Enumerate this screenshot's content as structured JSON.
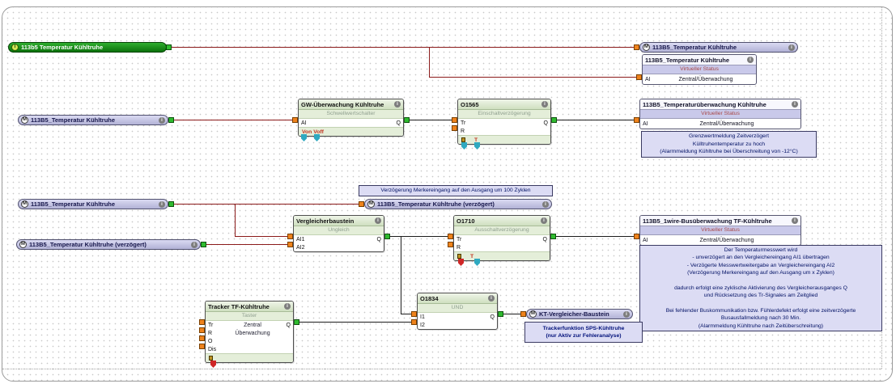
{
  "colors": {
    "analog_wire": "#8b1a1a",
    "binary_wire": "#1c1c1c",
    "input_port": "#ef831c",
    "output_port": "#2fbb2f",
    "merker_pill_fill": "#c8c8ea",
    "input_pill_fill": "#169416",
    "note_fill": "#dcdcf4"
  },
  "icons": {
    "info": "i"
  },
  "pills": {
    "input_temp": {
      "badge": "I",
      "label": "113b5  Temperatur Kühltruhe"
    },
    "m_temp_top": {
      "badge": "M",
      "label": "113B5_Temperatur Kühltruhe"
    },
    "m_temp_left1": {
      "badge": "M",
      "label": "113B5_Temperatur Kühltruhe"
    },
    "m_temp_left2": {
      "badge": "M",
      "label": "113B5_Temperatur Kühltruhe"
    },
    "m_temp_delayed_left": {
      "badge": "M",
      "label": "113B5_Temperatur Kühltruhe (verzögert)"
    },
    "m_temp_delayed_mid": {
      "badge": "M",
      "label": "113B5_Temperatur Kühltruhe (verzögert)"
    },
    "m_kt_vergleicher": {
      "badge": "M",
      "label": "KT-Vergleicher-Baustein"
    }
  },
  "status_blocks": {
    "temp": {
      "title": "113B5_Temperatur Kühltruhe",
      "subtitle": "Virtueller Status",
      "port": "AI",
      "value": "Zentral/Überwachung"
    },
    "ueberwachung": {
      "title": "113B5_Temperaturüberwachung Kühltruhe",
      "subtitle": "Virtueller Status",
      "port": "AI",
      "value": "Zentral/Überwachung"
    },
    "onewire": {
      "title": "113B5_1wire-Busüberwachung TF-Kühltruhe",
      "subtitle": "Virtueller Status",
      "port": "AI",
      "value": "Zentral/Überwachung"
    }
  },
  "blocks": {
    "gw": {
      "title": "GW-Überwachung Kühltruhe",
      "subtitle": "Schwellwertschalter",
      "in1": "AI",
      "out": "Q",
      "footer": "Von Voff"
    },
    "o1565": {
      "title": "O1565",
      "subtitle": "Einschaltverzögerung",
      "in1": "Tr",
      "in2": "R",
      "out": "Q",
      "param": "T"
    },
    "vergleicher": {
      "title": "Vergleicherbaustein",
      "subtitle": "Ungleich",
      "in1": "AI1",
      "in2": "AI2",
      "out": "Q"
    },
    "o1710": {
      "title": "O1710",
      "subtitle": "Ausschaltverzögerung",
      "in1": "Tr",
      "in2": "R",
      "out": "Q",
      "param": "T"
    },
    "o1834": {
      "title": "O1834",
      "subtitle": "UND",
      "in1": "I1",
      "in2": "I2",
      "out": "Q"
    },
    "tracker": {
      "title": "Tracker TF-Kühltruhe",
      "subtitle": "Taster",
      "in1": "Tr",
      "in2": "R",
      "in3": "O",
      "in4": "Dis",
      "out": "Q",
      "body1": "Zentral",
      "body2": "Überwachung"
    }
  },
  "notes": {
    "grenzwert": {
      "line1": "Grenzwertmeldung Zeitverzögert",
      "line2": "Külltruhentemperatur zu hoch",
      "line3": "(Alarmmeldung Kühltruhe bei Überschreitung von -12°C)"
    },
    "delay_banner": {
      "text": "Verzögerung Merkereingang  auf den Ausgang um 100 Zyklen"
    },
    "description": {
      "line1": "Der Temperaturmesswert wird",
      "line2": "- unverzögert an den Vergleichereingang AI1 übertragen",
      "line3": "- Verzögerte Messwertweitergabe an Vergleichereingang AI2",
      "line4": "(Verzögerung Merkereingang  auf den Ausgang um x Zyklen)",
      "line5": "",
      "line6": "dadurch erfolgt eine zyklische Aktivierung des Vergleicherausganges Q",
      "line7": "und Rücksetzung des Tr-Signales am Zeitglied",
      "line8": "",
      "line9": "Bei fehlender Buskommunikation bzw. Fühlerdefekt erfolgt eine zeitverzögerte",
      "line10": "Busausfallmeldung nach 30 Min.",
      "line11": "(Alarmmeldung Kühltruhe nach Zeitüberschreitung)"
    },
    "tracker_note": {
      "line1": "Trackerfunktion SPS-Kühltruhe",
      "line2": "(nur Aktiv zur Fehleranalyse)"
    }
  }
}
